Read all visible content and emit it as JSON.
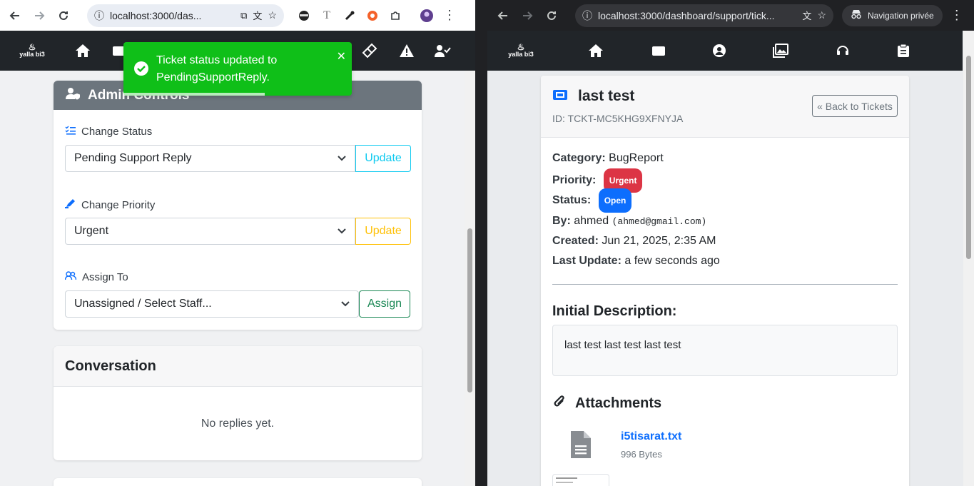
{
  "left_browser": {
    "url": "localhost:3000/das...",
    "icons": [
      "back-arrow-icon",
      "forward-arrow-icon",
      "reload-icon",
      "site-info-icon",
      "install-icon",
      "translate-icon",
      "star-icon",
      "extension-ninja-icon",
      "extension-text-icon",
      "eyedropper-icon",
      "extension-orange-icon",
      "puzzle-icon",
      "avatar-icon",
      "more-icon"
    ]
  },
  "left_nav": {
    "logo": "yalla bi3",
    "icons": [
      "home-icon",
      "wallet-icon",
      "ticket-icon",
      "warning-icon",
      "user-check-icon"
    ]
  },
  "toast": {
    "message": "Ticket status updated to PendingSupportReply.",
    "color": "#0fbf18"
  },
  "admin": {
    "title": "Admin Controls",
    "status_label": "Change Status",
    "status_value": "Pending Support Reply",
    "status_button": "Update",
    "priority_label": "Change Priority",
    "priority_value": "Urgent",
    "priority_button": "Update",
    "assign_label": "Assign To",
    "assign_value": "Unassigned / Select Staff...",
    "assign_button": "Assign"
  },
  "conversation": {
    "title": "Conversation",
    "empty_text": "No replies yet."
  },
  "right_browser": {
    "url": "localhost:3000/dashboard/support/tick...",
    "private_label": "Navigation privée"
  },
  "right_nav": {
    "logo": "yalla bi3",
    "icons": [
      "home-icon",
      "wallet-icon",
      "user-icon",
      "images-icon",
      "headset-icon",
      "clipboard-icon"
    ]
  },
  "ticket": {
    "title": "last test",
    "id_text": "ID: TCKT-MC5KHG9XFNYJA",
    "back_button": "« Back to Tickets",
    "category_label": "Category:",
    "category_value": "BugReport",
    "priority_label": "Priority:",
    "priority_value": "Urgent",
    "status_label": "Status:",
    "status_value": "Open",
    "by_label": "By:",
    "by_value": "ahmed",
    "by_email": "(ahmed@gmail.com)",
    "created_label": "Created:",
    "created_value": "Jun 21, 2025, 2:35 AM",
    "updated_label": "Last Update:",
    "updated_value": "a few seconds ago",
    "description_title": "Initial Description:",
    "description_text": "last test last test last test",
    "attachments_title": "Attachments",
    "file_name": "i5tisarat.txt",
    "file_size": "996 Bytes"
  },
  "colors": {
    "info": "#0dcaf0",
    "warning": "#ffc107",
    "success": "#198754",
    "danger": "#dc3545",
    "primary": "#0d6efd",
    "admin_header": "#6c757d"
  }
}
